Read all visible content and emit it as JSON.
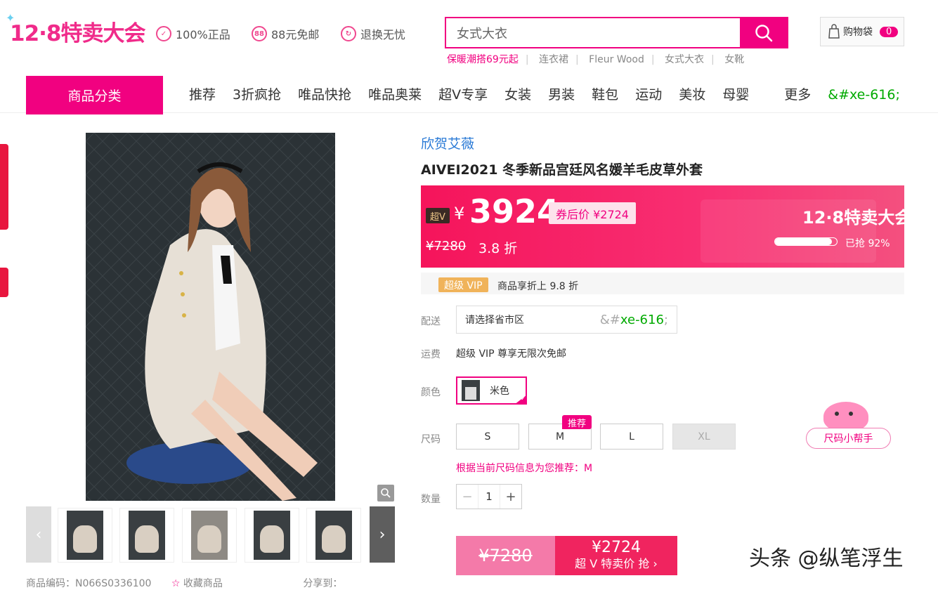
{
  "header": {
    "logo": "12·8特卖大会",
    "promises": [
      {
        "icon": "shield-check-icon",
        "glyph": "✓",
        "label": "100%正品"
      },
      {
        "icon": "free-shipping-88-icon",
        "glyph": "88",
        "label": "88元免邮"
      },
      {
        "icon": "return-exchange-icon",
        "glyph": "↻",
        "label": "退换无忧"
      }
    ],
    "search": {
      "value": "女式大衣"
    },
    "hotwords": [
      "保暖潮搭69元起",
      "连衣裙",
      "Fleur Wood",
      "女式大衣",
      "女靴"
    ],
    "cart": {
      "label": "购物袋",
      "count": "0"
    }
  },
  "nav": {
    "category_button": "商品分类",
    "items": [
      "推荐",
      "3折疯抢",
      "唯品快抢",
      "唯品奥莱",
      "超V专享",
      "女装",
      "男装",
      "鞋包",
      "运动",
      "美妆",
      "母婴"
    ],
    "more_label": "更多",
    "more_glyph": "&#xe-616;"
  },
  "gallery": {
    "bottom_info": "商品编码：N066S0336100",
    "favorite_label": "收藏商品",
    "share_label": "分享到："
  },
  "product": {
    "brand": "欣贺艾薇",
    "title": "AIVEI2021 冬季新品宫廷风名媛羊毛皮草外套",
    "price": {
      "vip_tag": "超V",
      "currency": "¥",
      "amount": "3924",
      "coupon": "券后价 ¥2724",
      "original": "¥7280",
      "discount": "3.8 折",
      "sale_event": "12·8特卖大会",
      "sold_label": "已抢 92%",
      "sold_fraction": 0.92
    },
    "vip": {
      "badge": "超级 VIP",
      "text": "商品享折上 9.8 折"
    },
    "delivery": {
      "label": "配送",
      "placeholder": "请选择省市区",
      "glyph_prefix": "&#",
      "glyph_code": "xe-616",
      "glyph_suffix": ";"
    },
    "shipping": {
      "label": "运费",
      "text": "超级 VIP 尊享无限次免邮"
    },
    "color": {
      "label": "颜色",
      "selected": "米色"
    },
    "size": {
      "label": "尺码",
      "options": [
        "S",
        "M",
        "L",
        "XL"
      ],
      "recommended_tag": "推荐",
      "hint": "根据当前尺码信息为您推荐：M",
      "helper": "尺码小帮手"
    },
    "quantity": {
      "label": "数量",
      "value": "1",
      "minus": "−",
      "plus": "+"
    },
    "buy": {
      "original": "¥7280",
      "price": "¥2724",
      "action": "超 V 特卖价 抢 ›"
    }
  },
  "watermark": "头条 @纵笔浮生",
  "colors": {
    "brand_pink": "#f10180",
    "price_band": "#f5145b",
    "link_blue": "#2a7ad6"
  }
}
